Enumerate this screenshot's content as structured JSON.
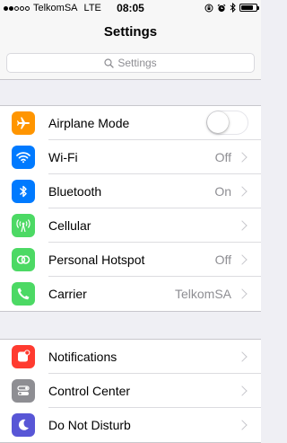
{
  "status_bar": {
    "signal_bars": 5,
    "signal_filled": 2,
    "carrier": "TelkomSA",
    "network": "LTE",
    "time": "08:05",
    "icons": [
      "lock-rotation-icon",
      "alarm-icon",
      "bluetooth-icon"
    ],
    "battery_level": 0.85
  },
  "nav": {
    "title": "Settings"
  },
  "search": {
    "placeholder": "Settings"
  },
  "group1": [
    {
      "name": "airplane-mode",
      "label": "Airplane Mode",
      "icon": "airplane-icon",
      "icon_bg": "#ff9500",
      "control": "toggle",
      "on": false
    },
    {
      "name": "wifi",
      "label": "Wi-Fi",
      "value": "Off",
      "icon": "wifi-icon",
      "icon_bg": "#007aff",
      "control": "chevron"
    },
    {
      "name": "bluetooth",
      "label": "Bluetooth",
      "value": "On",
      "icon": "bluetooth-icon",
      "icon_bg": "#007aff",
      "control": "chevron"
    },
    {
      "name": "cellular",
      "label": "Cellular",
      "value": "",
      "icon": "cellular-antenna-icon",
      "icon_bg": "#4cd964",
      "control": "chevron"
    },
    {
      "name": "personal-hotspot",
      "label": "Personal Hotspot",
      "value": "Off",
      "icon": "hotspot-icon",
      "icon_bg": "#4cd964",
      "control": "chevron"
    },
    {
      "name": "carrier",
      "label": "Carrier",
      "value": "TelkomSA",
      "icon": "phone-icon",
      "icon_bg": "#4cd964",
      "control": "chevron"
    }
  ],
  "group2": [
    {
      "name": "notifications",
      "label": "Notifications",
      "icon": "notifications-icon",
      "icon_bg": "#ff3b30",
      "control": "chevron"
    },
    {
      "name": "control-center",
      "label": "Control Center",
      "icon": "control-center-icon",
      "icon_bg": "#8e8e93",
      "control": "chevron"
    },
    {
      "name": "do-not-disturb",
      "label": "Do Not Disturb",
      "icon": "moon-icon",
      "icon_bg": "#5856d6",
      "control": "chevron"
    }
  ]
}
